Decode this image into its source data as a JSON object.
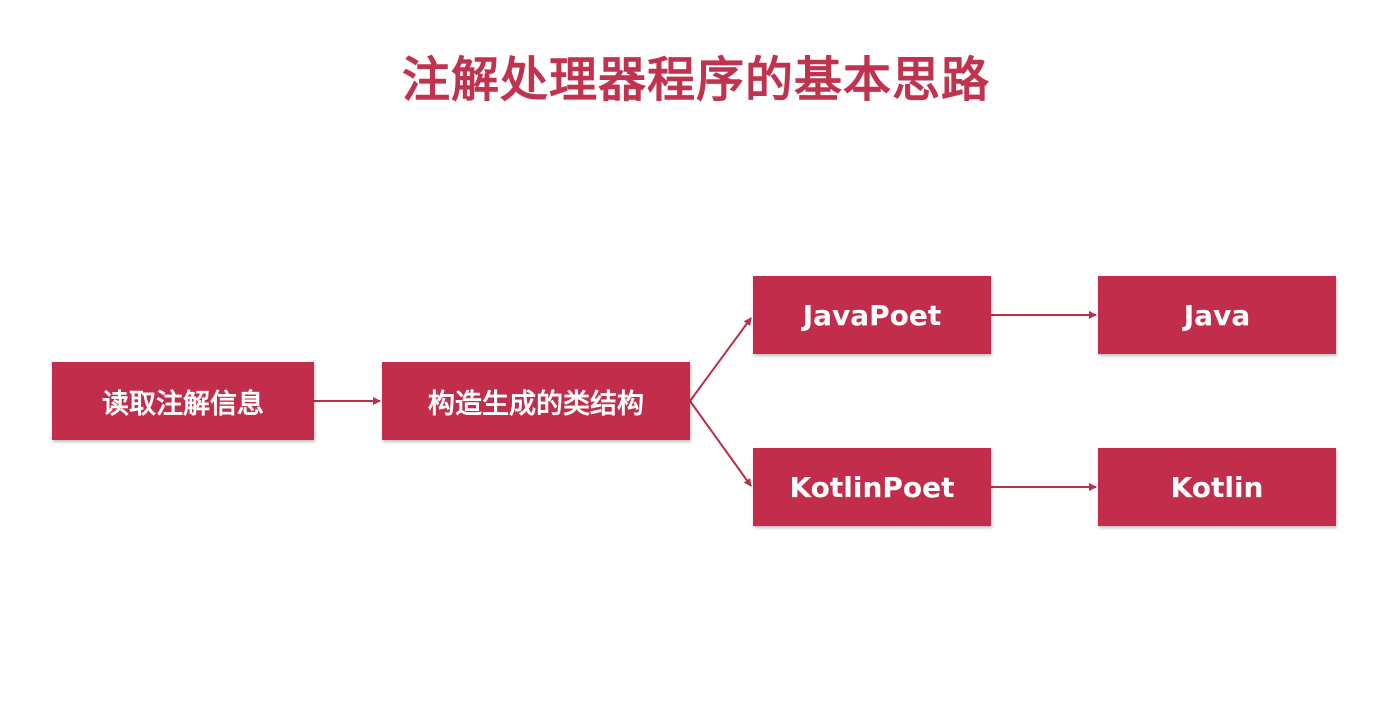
{
  "title": "注解处理器程序的基本思路",
  "nodes": {
    "read": "读取注解信息",
    "build": "构造生成的类结构",
    "javapoet": "JavaPoet",
    "kotlinpoet": "KotlinPoet",
    "java": "Java",
    "kotlin": "Kotlin"
  },
  "colors": {
    "title": "#c0324e",
    "box": "#c22d4b",
    "arrow": "#b5314c",
    "text": "#ffffff"
  }
}
